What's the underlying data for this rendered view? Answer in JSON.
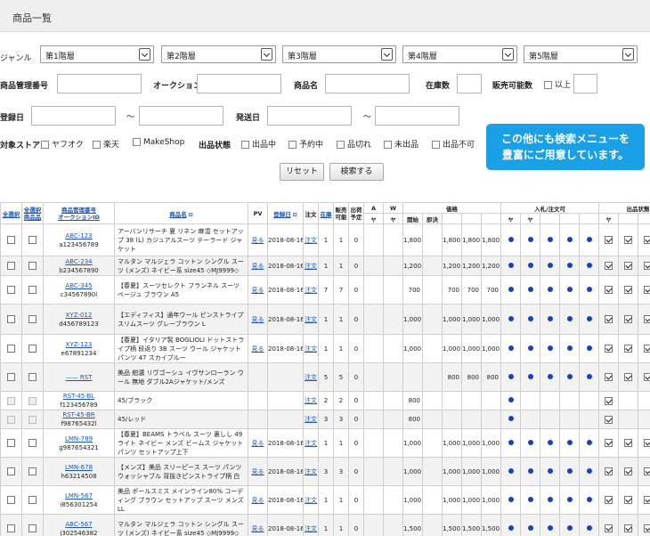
{
  "page_title": "商品一覧",
  "filters": {
    "genre_label": "ジャンル",
    "levels": [
      "第1階層",
      "第2階層",
      "第3階層",
      "第4階層",
      "第5階層"
    ],
    "product_id_label": "商品管理番号",
    "auction_id_label": "オークションID",
    "name_label": "商品名",
    "stock_label": "在庫数",
    "sellable_label": "販売可能数",
    "or_more_label": "以上",
    "reg_date_label": "登録日",
    "ship_date_label": "発送日",
    "range_sep": "～",
    "store_label": "対象ストア",
    "stores": [
      "ヤフオク",
      "楽天",
      "MakeShop"
    ],
    "status_label": "出品状態",
    "statuses": [
      "出品中",
      "予約中",
      "品切れ",
      "未出品",
      "出品不可"
    ],
    "reset": "リセット",
    "search": "検索する"
  },
  "banner": {
    "line1": "この他にも検索メニューを",
    "line2": "豊富にご用意しています。"
  },
  "table": {
    "h_all": "全選択",
    "h_all_sub": "全選択\n商品品",
    "h_code": "商品管理番号\nオークションID",
    "h_name": "商品名",
    "h_pv": "PV",
    "h_date": "登録日",
    "h_order": "注文",
    "h_stock": "在庫",
    "h_sellable": "販売\n可能",
    "h_ship": "出荷\n予定",
    "h_a": "A",
    "h_w": "W",
    "h_price": "価格",
    "h_bid": "入札/注文可",
    "h_status": "出品状態",
    "sub_ya": "ヤ",
    "sub_open": "開始",
    "sub_buy": "即決",
    "sub_r": "R",
    "sub_y": "Y",
    "sub_m": "M",
    "rows": [
      {
        "c1": "ABC-123",
        "c2": "a123456789",
        "name": "アーバンリサーチ 夏 リネン 麻混 セットアップ 38 (L) カジュアルスーツ テーラード ジャケット",
        "pv": "見る",
        "date": "2018-08-16",
        "order": "注文",
        "stock": "1",
        "sell": "1",
        "ship": "0",
        "open": "1,800",
        "buy": "",
        "r": "1,800",
        "y": "1,800",
        "m": "1,800",
        "dots": [
          1,
          1,
          1,
          1,
          1
        ],
        "checks": [
          1,
          1,
          1,
          1
        ],
        "grey": false,
        "link": true
      },
      {
        "c1": "ABC-234",
        "c2": "b234567890",
        "name": "マルタン マルジェラ コットン シングル スーツ (メンズ) ネイビー系 size45 ◇MJ9999◇",
        "pv": "見る",
        "date": "2018-08-16",
        "order": "注文",
        "stock": "1",
        "sell": "1",
        "ship": "0",
        "open": "1,200",
        "buy": "",
        "r": "1,200",
        "y": "1,200",
        "m": "1,200",
        "dots": [
          1,
          1,
          1,
          1,
          1
        ],
        "checks": [
          1,
          1,
          1,
          1
        ],
        "grey": true,
        "link": true
      },
      {
        "c1": "ABC-345",
        "c2": "c34567890l",
        "name": "【春夏】スーツセレクト フランネル スーツ ベージュ ブラウン A5",
        "pv": "見る",
        "date": "2018-08-16",
        "order": "注文",
        "stock": "7",
        "sell": "7",
        "ship": "0",
        "open": "700",
        "buy": "",
        "r": "700",
        "y": "700",
        "m": "700",
        "dots": [
          1,
          1,
          1,
          1,
          1
        ],
        "checks": [
          1,
          1,
          1,
          1
        ],
        "grey": false,
        "link": true
      },
      {
        "c1": "XYZ-012",
        "c2": "d456789123",
        "name": "【エディフィス】通年ウール ピンストライプ スリムスーツ グレーブラウン L",
        "pv": "見る",
        "date": "2018-08-16",
        "order": "注文",
        "stock": "1",
        "sell": "1",
        "ship": "0",
        "open": "1,000",
        "buy": "",
        "r": "1,000",
        "y": "1,000",
        "m": "1,000",
        "dots": [
          1,
          1,
          1,
          1,
          1
        ],
        "checks": [
          1,
          1,
          1,
          1
        ],
        "grey": true,
        "link": true
      },
      {
        "c1": "XYZ-123",
        "c2": "e67891234",
        "name": "【春夏】イタリア製 BOGLIOLI ドットストライプ柄 段返り 3B スーツ ウール ジャケット パンツ 47 スカイブルー",
        "pv": "見る",
        "date": "2018-08-16",
        "order": "注文",
        "stock": "1",
        "sell": "1",
        "ship": "0",
        "open": "1,000",
        "buy": "",
        "r": "1,000",
        "y": "1,000",
        "m": "1,000",
        "dots": [
          1,
          1,
          1,
          1,
          1
        ],
        "checks": [
          1,
          1,
          1,
          1
        ],
        "grey": false,
        "link": true
      },
      {
        "c1": "—— RST",
        "c2": "",
        "name": "美品 紺濃 リヴゴーシュ イヴサンローラン ウール 無地 ダブル2Aジャケット/メンズ",
        "pv": "",
        "date": "",
        "order": "注文",
        "stock": "5",
        "sell": "5",
        "ship": "0",
        "open": "",
        "buy": "",
        "r": "800",
        "y": "800",
        "m": "800",
        "dots": [
          1,
          1,
          1,
          1,
          1
        ],
        "checks": [
          1,
          1,
          1,
          1
        ],
        "grey": true,
        "link": false
      },
      {
        "c1": "RST-45-BL",
        "c2": "f123456789",
        "name": "45/ブラック",
        "pv": "",
        "date": "",
        "order": "注文",
        "stock": "2",
        "sell": "2",
        "ship": "0",
        "open": "800",
        "buy": "",
        "r": "",
        "y": "",
        "m": "",
        "dots": [
          1,
          0,
          0,
          0,
          0
        ],
        "checks": [
          1,
          0,
          0,
          0
        ],
        "grey": false,
        "link": false,
        "sub": true
      },
      {
        "c1": "RST-45-BR",
        "c2": "f98765432l",
        "name": "45/レッド",
        "pv": "",
        "date": "",
        "order": "注文",
        "stock": "3",
        "sell": "3",
        "ship": "0",
        "open": "800",
        "buy": "",
        "r": "",
        "y": "",
        "m": "",
        "dots": [
          1,
          0,
          0,
          0,
          0
        ],
        "checks": [
          1,
          0,
          0,
          0
        ],
        "grey": true,
        "link": false,
        "sub": true
      },
      {
        "c1": "LMN-789",
        "c2": "g987654321",
        "name": "【春夏】BEAMS トラベル スーツ 裏しし 49 ライト ネイビー メンズ ビームス ジャケット パンツ セットアップ上下",
        "pv": "見る",
        "date": "2018-08-16",
        "order": "注文",
        "stock": "1",
        "sell": "1",
        "ship": "0",
        "open": "1,000",
        "buy": "",
        "r": "1,000",
        "y": "1,000",
        "m": "1,000",
        "dots": [
          1,
          1,
          1,
          1,
          1
        ],
        "checks": [
          1,
          1,
          1,
          1
        ],
        "grey": false,
        "link": true
      },
      {
        "c1": "LMN-678",
        "c2": "h63214508",
        "name": "【メンズ】美品 スリーピース スーツ パンツ ウォッシャブル 背抜きピンストライプ柄 白",
        "pv": "見る",
        "date": "2018-08-16",
        "order": "注文",
        "stock": "3",
        "sell": "3",
        "ship": "0",
        "open": "1,000",
        "buy": "",
        "r": "1,000",
        "y": "1,000",
        "m": "1,000",
        "dots": [
          1,
          1,
          1,
          1,
          1
        ],
        "checks": [
          1,
          1,
          1,
          1
        ],
        "grey": true,
        "link": true
      },
      {
        "c1": "LMN-567",
        "c2": "i856301254",
        "name": "美品 ポールスミス メインライン80% コーディング ブラウン セットアップ スーツ メンズ LL",
        "pv": "見る",
        "date": "2018-08-16",
        "order": "注文",
        "stock": "1",
        "sell": "1",
        "ship": "0",
        "open": "1,000",
        "buy": "",
        "r": "1,000",
        "y": "1,000",
        "m": "1,000",
        "dots": [
          1,
          1,
          1,
          1,
          1
        ],
        "checks": [
          1,
          1,
          1,
          1
        ],
        "grey": false,
        "link": true
      },
      {
        "c1": "ABC-567",
        "c2": "j302546382",
        "name": "マルタン マルジェラ コットン シングル スーツ (メンズ) ネイビー系 size45 ◇MJ9999◇",
        "pv": "見る",
        "date": "2018-08-16",
        "order": "注文",
        "stock": "1",
        "sell": "1",
        "ship": "0",
        "open": "1,500",
        "buy": "",
        "r": "1,500",
        "y": "1,500",
        "m": "1,500",
        "dots": [
          1,
          1,
          1,
          1,
          1
        ],
        "checks": [
          1,
          1,
          1,
          1
        ],
        "grey": true,
        "link": true
      }
    ]
  }
}
